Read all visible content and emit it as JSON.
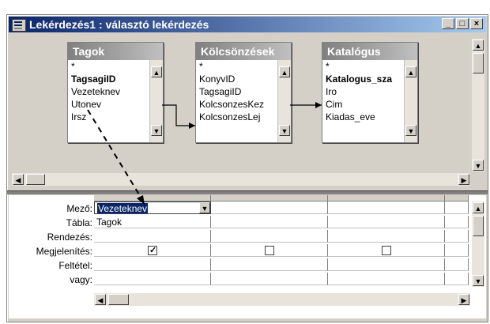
{
  "window": {
    "title": "Lekérdezés1 : választó lekérdezés"
  },
  "tables": [
    {
      "name": "Tagok",
      "fields": [
        "*",
        "TagsagiID",
        "Vezeteknev",
        "Utonev",
        "Irsz"
      ],
      "bold_index": 1
    },
    {
      "name": "Kölcsönzések",
      "fields": [
        "*",
        "KonyvID",
        "TagsagiID",
        "KolcsonzesKez",
        "KolcsonzesLej"
      ],
      "bold_index": -1
    },
    {
      "name": "Katalógus",
      "fields": [
        "*",
        "Katalogus_sza",
        "Iro",
        "Cim",
        "Kiadas_eve"
      ],
      "bold_index": 1
    }
  ],
  "grid": {
    "row_labels": [
      "Mező:",
      "Tábla:",
      "Rendezés:",
      "Megjelenítés:",
      "Feltétel:",
      "vagy:"
    ],
    "columns": [
      {
        "field": "Vezeteknev",
        "table": "Tagok",
        "show": true
      },
      {
        "field": "",
        "table": "",
        "show": false
      },
      {
        "field": "",
        "table": "",
        "show": false
      },
      {
        "field": "",
        "table": "",
        "show": false
      }
    ]
  }
}
